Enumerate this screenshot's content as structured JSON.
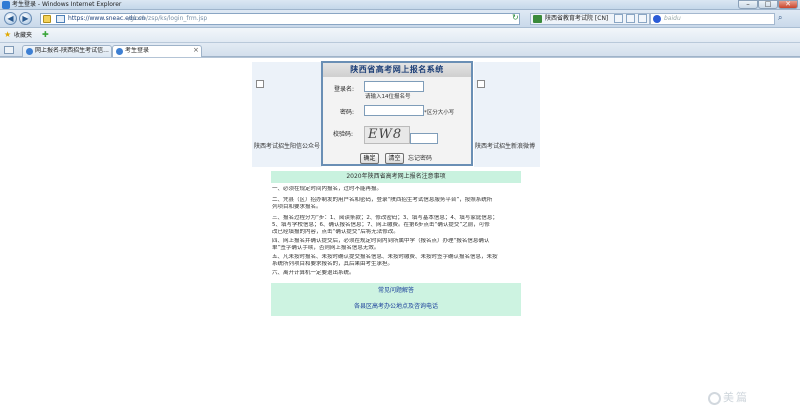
{
  "window": {
    "title": "考生登录 - Windows Internet Explorer",
    "minimize": "–",
    "maximize": "□",
    "close": "✕"
  },
  "address_bar": {
    "url_host": "https://www.sneac.edu.cn",
    "url_path": "/gkwb/zsp/ks/login_frm.jsp",
    "site_identity": "陕西省教育考试院 [CN]",
    "search_placeholder": "baidu",
    "back_glyph": "◀",
    "forward_glyph": "▶",
    "refresh_glyph": "↻",
    "search_glyph": "⌕"
  },
  "favorites_bar": {
    "label": "收藏夹",
    "star_glyph": "★",
    "add_glyph": "✚"
  },
  "tabs": [
    {
      "label": "网上报名-陕西招生考试信..."
    },
    {
      "label": "考生登录"
    }
  ],
  "tab_close": "×",
  "banners": {
    "left_label": "陕西考试招生阳信公众号",
    "right_label": "陕西考试招生新浪微博"
  },
  "login": {
    "title": "陕西省高考网上报名系统",
    "username_label": "登录名:",
    "username_value": "",
    "username_hint": "请输入14位报名号",
    "password_label": "密码:",
    "password_value": "",
    "password_hint": "*区分大小写",
    "captcha_label": "校验码:",
    "captcha_value": "",
    "captcha_text": "EW8",
    "submit_label": "确定",
    "clear_label": "清空",
    "forgot_label": "忘记密码"
  },
  "notice": {
    "title": "2020年陕西省高考网上报名注意事项",
    "lines": [
      "一、必须在规定时间内报名，过时不能再报。",
      "二、凭县（区）招办制发的用户名和密码，登录“陕西招生考试信息服务平台”，按照系统所",
      "列项目和要求报名。",
      "三、报名过程分为“步：1、阅读条款；2、修改密码；3、填写基本信息；4、填写家庭信息；",
      "5、填写学校信息；6、确认报名信息；7、网上缴费。在第6步点击“确认提交”之前，可修",
      "改已经填报的内容，点击“确认提交”后将无法修改。",
      "四、网上报名并确认提交后，必须在规定时间内到所属中学（报名点）办理“报名信息确认",
      "单”签字确认手续，否则网上报名信息无效。",
      "五、凡未按时报名、未按时确认提交报名信息、未按时缴费、未按时签字确认报名信息，未按",
      "系统所列项目和要求报名的，其后果由考生承担。",
      "六、离开计算机一定要退出系统。"
    ],
    "faq_label": "常见问题解答",
    "phone_label": "各县区高考办公地点及咨询电话"
  },
  "watermark": "美篇"
}
